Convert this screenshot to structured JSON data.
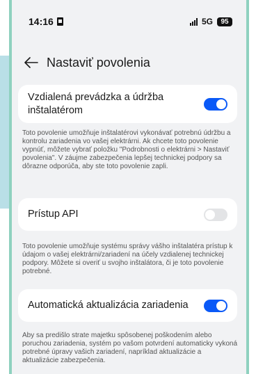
{
  "status_bar": {
    "time": "14:16",
    "network": "5G",
    "battery": "95"
  },
  "header": {
    "title": "Nastaviť povolenia"
  },
  "settings": [
    {
      "label": "Vzdialená prevádzka a údržba inštalatérom",
      "enabled": true,
      "description": "Toto povolenie umožňuje inštalatérovi vykonávať potrebnú údržbu a kontrolu zariadenia vo vašej elektrárni. Ak chcete toto povolenie vypnúť, môžete vybrať položku \"Podrobnosti o elektrárni > Nastaviť povolenia\". V záujme zabezpečenia lepšej technickej podpory sa dôrazne odporúča, aby ste toto povolenie zapli."
    },
    {
      "label": "Prístup API",
      "enabled": false,
      "description": "Toto povolenie umožňuje systému správy vášho inštalatéra prístup k údajom o vašej elektrárni/zariadení na účely vzdialenej technickej podpory. Môžete si overiť u svojho inštalátora, či je toto povolenie potrebné."
    },
    {
      "label": "Automatická aktualizácia zariadenia",
      "enabled": true,
      "description": "Aby sa predišlo strate majetku spôsobenej poškodením alebo poruchou zariadenia, systém po vašom potvrdení automaticky vykoná potrebné úpravy vašich zariadení, napríklad aktualizácie a aktualizácie zabezpečenia."
    }
  ],
  "colors": {
    "accent": "#0a59f7",
    "background": "#f1f2f4",
    "card": "#ffffff"
  }
}
